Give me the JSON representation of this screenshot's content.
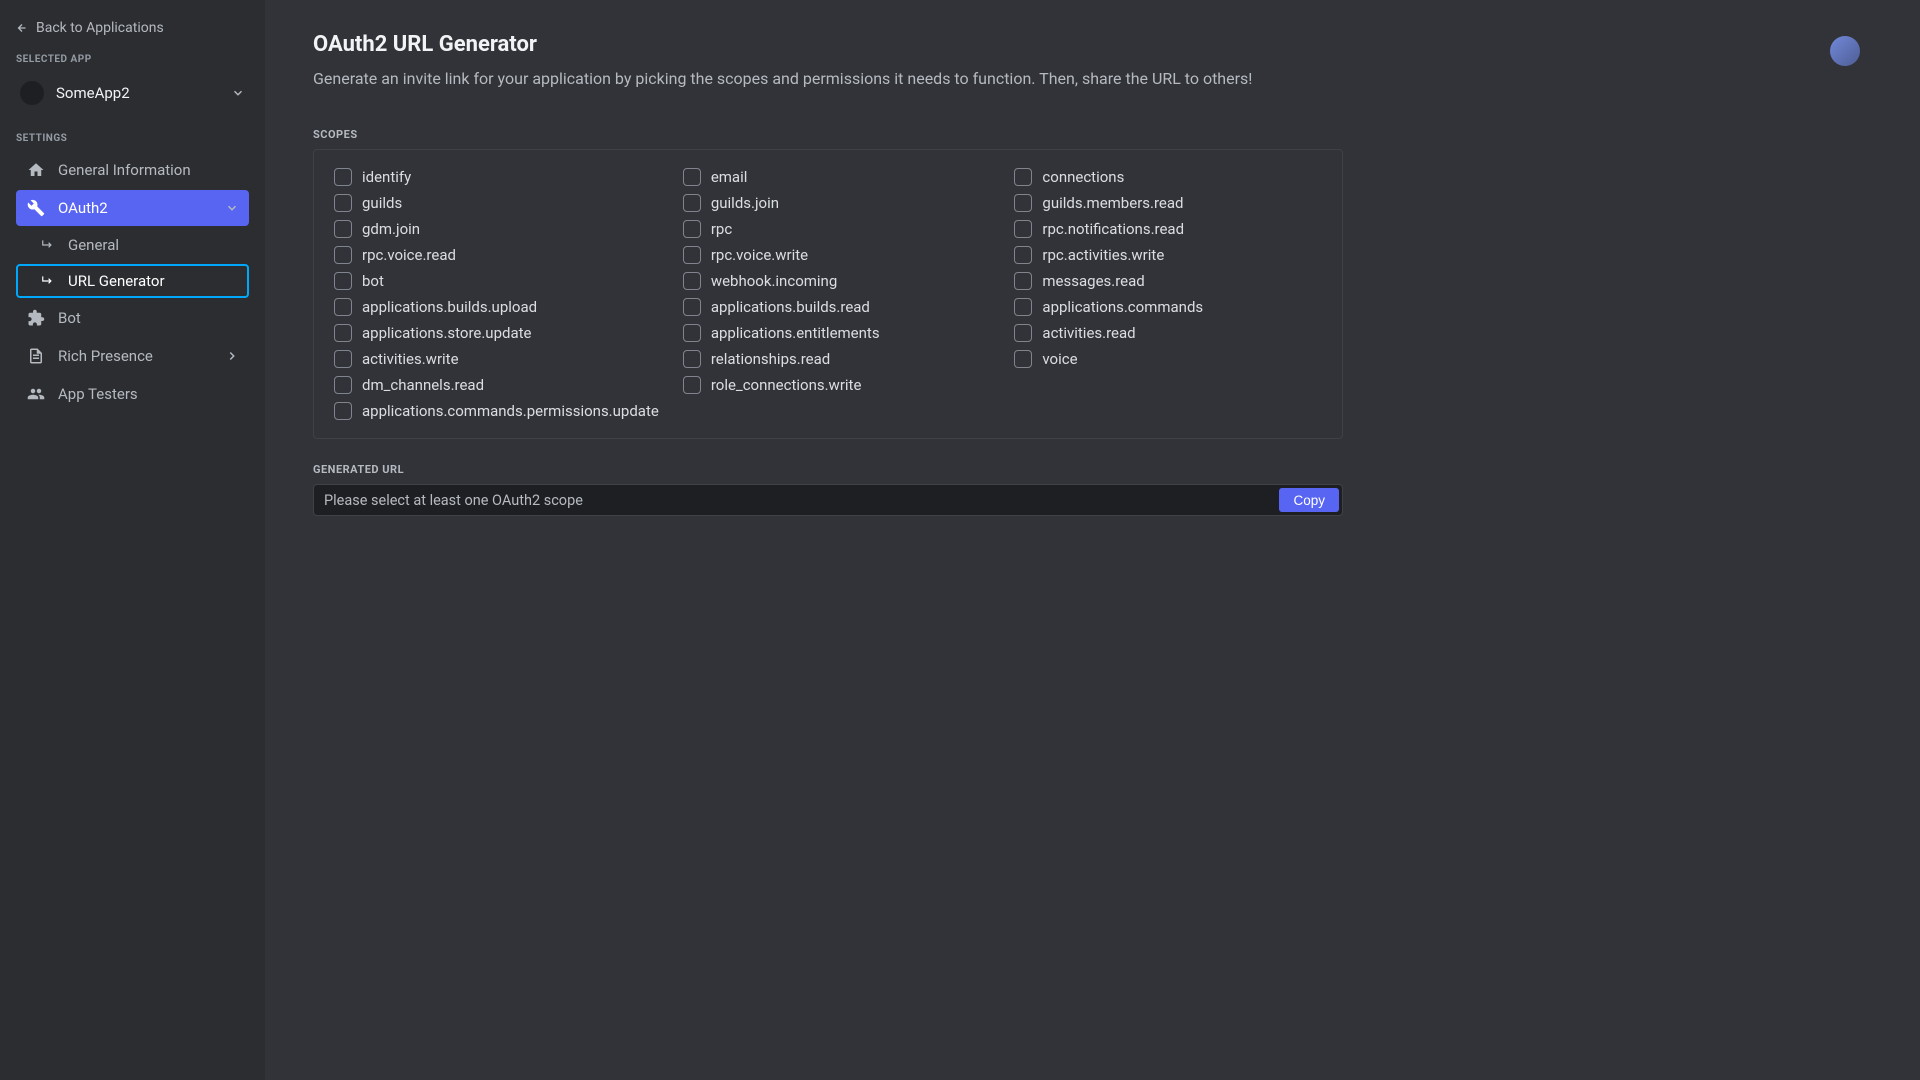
{
  "sidebar": {
    "back_label": "Back to Applications",
    "selected_app_header": "Selected App",
    "app_name": "SomeApp2",
    "settings_header": "Settings",
    "items": {
      "general_info": "General Information",
      "oauth2": "OAuth2",
      "oauth2_general": "General",
      "oauth2_url_gen": "URL Generator",
      "bot": "Bot",
      "rich_presence": "Rich Presence",
      "app_testers": "App Testers"
    }
  },
  "page": {
    "title": "OAuth2 URL Generator",
    "description": "Generate an invite link for your application by picking the scopes and permissions it needs to function. Then, share the URL to others!"
  },
  "scopes": {
    "header": "Scopes",
    "items": [
      "identify",
      "email",
      "connections",
      "guilds",
      "guilds.join",
      "guilds.members.read",
      "gdm.join",
      "rpc",
      "rpc.notifications.read",
      "rpc.voice.read",
      "rpc.voice.write",
      "rpc.activities.write",
      "bot",
      "webhook.incoming",
      "messages.read",
      "applications.builds.upload",
      "applications.builds.read",
      "applications.commands",
      "applications.store.update",
      "applications.entitlements",
      "activities.read",
      "activities.write",
      "relationships.read",
      "voice",
      "dm_channels.read",
      "role_connections.write",
      "",
      "applications.commands.permissions.update",
      "",
      ""
    ]
  },
  "generated_url": {
    "header": "Generated URL",
    "placeholder": "Please select at least one OAuth2 scope",
    "copy_label": "Copy"
  }
}
